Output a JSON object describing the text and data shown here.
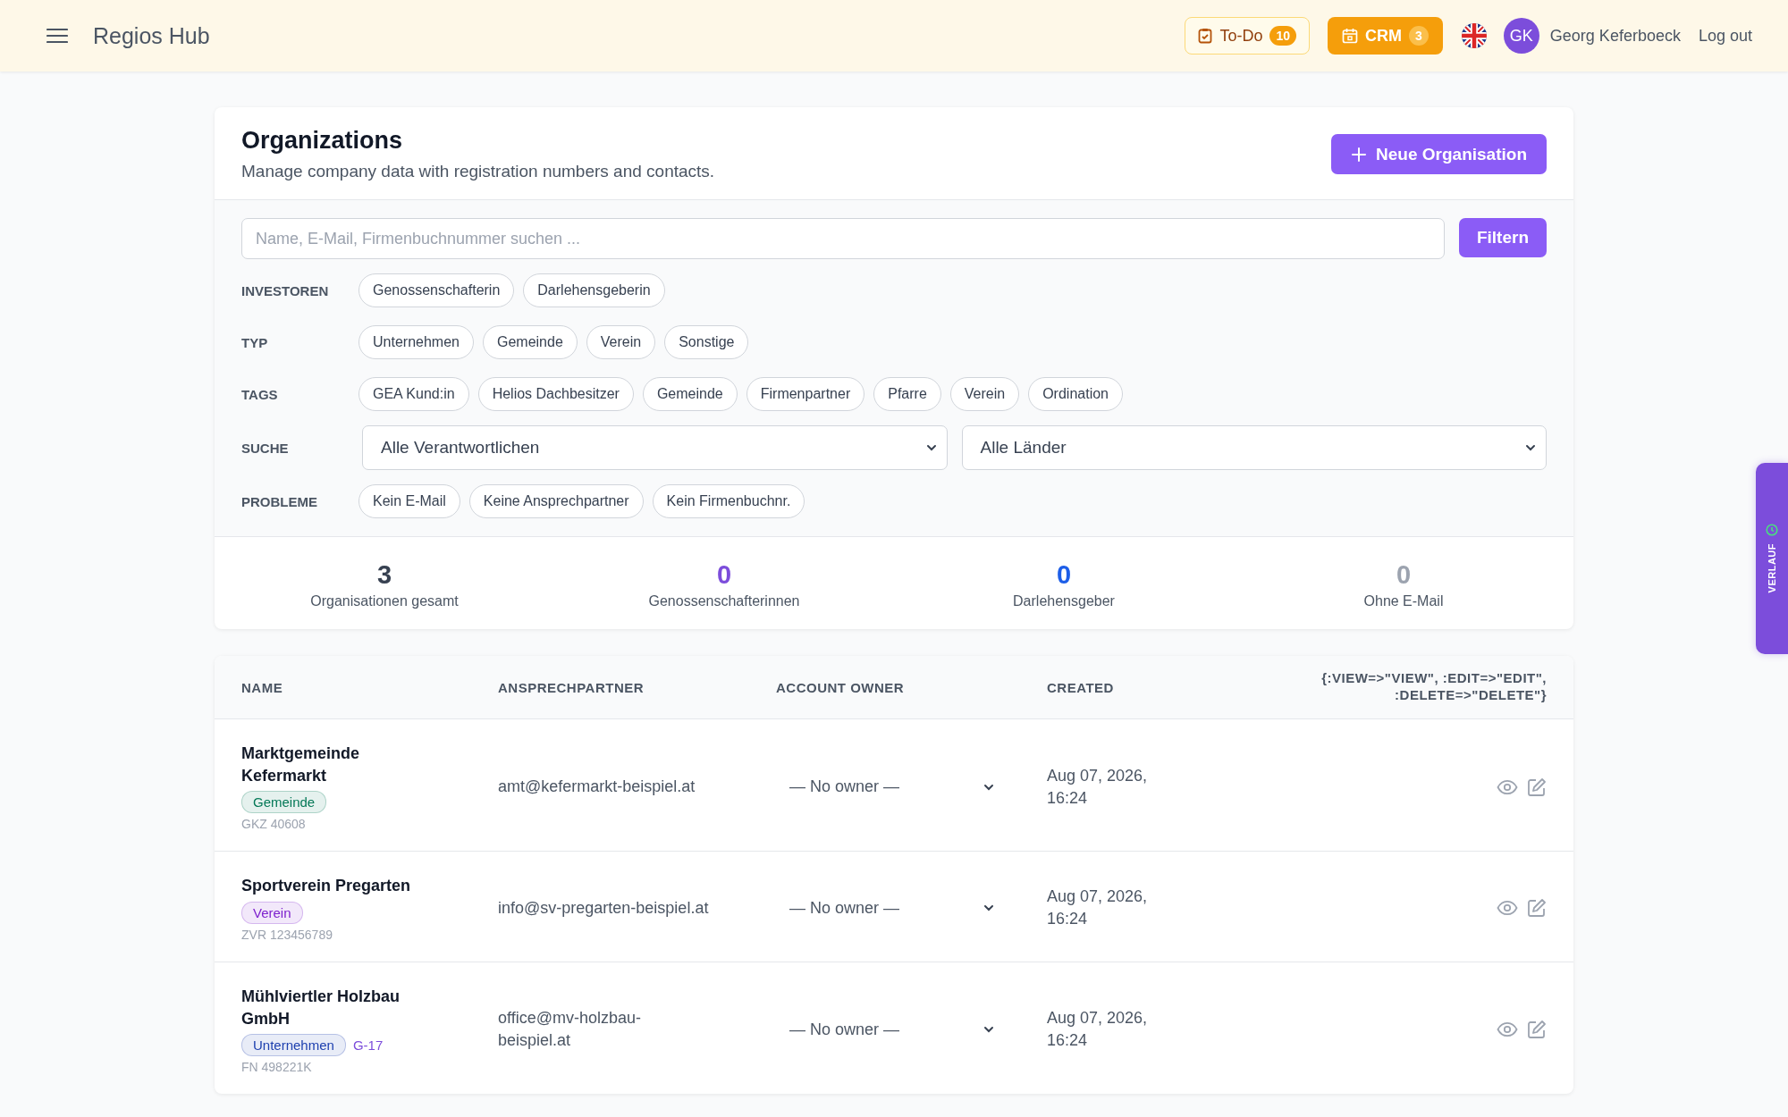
{
  "header": {
    "brand": "Regios Hub",
    "todo": {
      "label": "To-Do",
      "count": "10"
    },
    "crm": {
      "label": "CRM",
      "count": "3"
    },
    "avatar": "GK",
    "user": "Georg Keferboeck",
    "logout": "Log out"
  },
  "page": {
    "title": "Organizations",
    "subtitle": "Manage company data with registration numbers and contacts.",
    "new_button": "Neue Organisation",
    "search": {
      "placeholder": "Name, E-Mail, Firmenbuchnummer suchen ..."
    },
    "filter_button": "Filtern",
    "filter_groups": [
      {
        "label": "INVESTOREN",
        "kind": "chips",
        "chips": [
          {
            "label": "Genossenschafterin",
            "selected": false
          },
          {
            "label": "Darlehensgeberin",
            "selected": false
          }
        ]
      },
      {
        "label": "TYP",
        "kind": "chips",
        "chips": [
          {
            "label": "Unternehmen",
            "selected": false
          },
          {
            "label": "Gemeinde",
            "selected": false
          },
          {
            "label": "Verein",
            "selected": false
          },
          {
            "label": "Sonstige",
            "selected": false
          }
        ]
      },
      {
        "label": "TAGS",
        "kind": "chips",
        "chips": [
          {
            "label": "GEA Kund:in",
            "selected": false
          },
          {
            "label": "Helios Dachbesitzer",
            "selected": false
          },
          {
            "label": "Gemeinde",
            "selected": false
          },
          {
            "label": "Firmenpartner",
            "selected": false
          },
          {
            "label": "Pfarre",
            "selected": false
          },
          {
            "label": "Verein",
            "selected": false
          },
          {
            "label": "Ordination",
            "selected": false
          }
        ]
      },
      {
        "label": "SUCHE",
        "kind": "selects",
        "selects": [
          "Alle Verantwortlichen",
          "Alle Länder"
        ]
      },
      {
        "label": "PROBLEME",
        "kind": "chips",
        "chips": [
          {
            "label": "Kein E-Mail",
            "selected": false
          },
          {
            "label": "Keine Ansprechpartner",
            "selected": false
          },
          {
            "label": "Kein Firmenbuchnr.",
            "selected": false
          }
        ]
      }
    ],
    "stats": [
      {
        "value": "3",
        "label": "Organisationen gesamt",
        "color": "#374151"
      },
      {
        "value": "0",
        "label": "Genossenschafterinnen",
        "color": "#7c4ddb"
      },
      {
        "value": "0",
        "label": "Darlehensgeber",
        "color": "#1d5ee8"
      },
      {
        "value": "0",
        "label": "Ohne E-Mail",
        "color": "#9ca3af"
      }
    ]
  },
  "table": {
    "columns": [
      "NAME",
      "ANSPRECHPARTNER",
      "ACCOUNT OWNER",
      "CREATED",
      "{:VIEW=>\"VIEW\", :EDIT=>\"EDIT\", :DELETE=>\"DELETE\"}"
    ],
    "rows": [
      {
        "name": "Marktgemeinde Kefermarkt",
        "tag": {
          "label": "Gemeinde",
          "color": "#047857"
        },
        "id_line": "GKZ 40608",
        "contact": "amt@kefermarkt-beispiel.at",
        "owner": "— No owner —",
        "created": "Aug 07, 2026, 16:24"
      },
      {
        "name": "Sportverein Pregarten",
        "tag": {
          "label": "Verein",
          "color": "#7e22ce"
        },
        "id_line": "ZVR 123456789",
        "contact": "info@sv-pregarten-beispiel.at",
        "owner": "— No owner —",
        "created": "Aug 07, 2026, 16:24"
      },
      {
        "name": "Mühlviertler Holzbau GmbH",
        "tag": {
          "label": "Unternehmen",
          "color": "#1e40af"
        },
        "code": "G-17",
        "id_line": "FN 498221K",
        "contact": "office@mv-holzbau-beispiel.at",
        "owner": "— No owner —",
        "created": "Aug 07, 2026, 16:24"
      }
    ]
  },
  "side_tab": {
    "label": "VERLAUF"
  }
}
